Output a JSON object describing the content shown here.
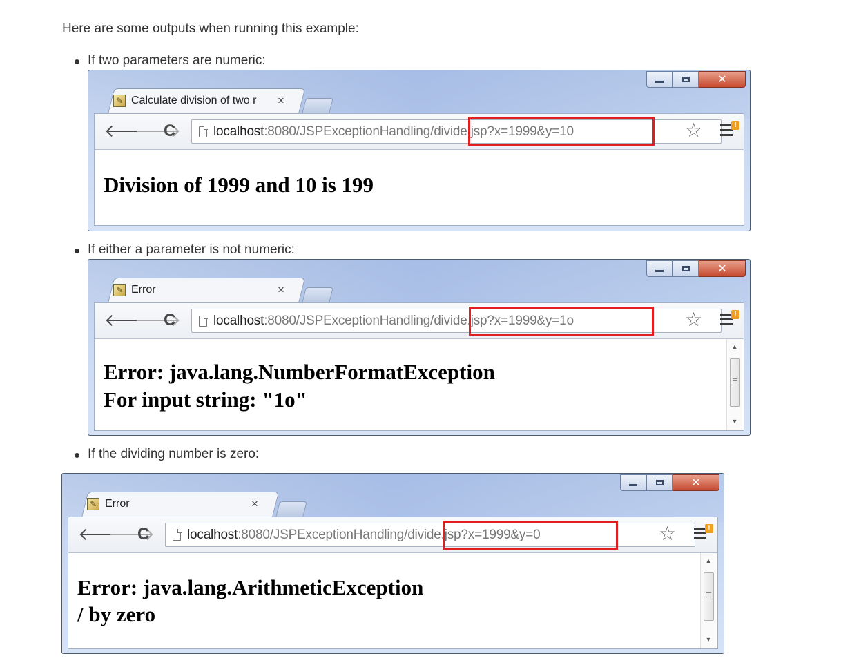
{
  "intro": "Here are some outputs when running this example:",
  "examples": [
    {
      "bullet": "If two parameters are numeric:",
      "tab_title": "Calculate division of two r",
      "url_host": "localhost",
      "url_rest": ":8080/JSPExceptionHandling/divide.jsp?x=1999&y=10",
      "lines": [
        "Division of 1999 and 10 is 199"
      ]
    },
    {
      "bullet": "If either a parameter is not numeric:",
      "tab_title": "Error",
      "url_host": "localhost",
      "url_rest": ":8080/JSPExceptionHandling/divide.jsp?x=1999&y=1o",
      "lines": [
        "Error: java.lang.NumberFormatException",
        "For input string: \"1o\""
      ]
    },
    {
      "bullet": "If the dividing number is zero:",
      "tab_title": "Error",
      "url_host": "localhost",
      "url_rest": ":8080/JSPExceptionHandling/divide.jsp?x=1999&y=0",
      "lines": [
        "Error: java.lang.ArithmeticException",
        "/ by zero"
      ]
    }
  ],
  "icons": {
    "back": "back-arrow-icon",
    "forward": "forward-arrow-icon",
    "reload": "reload-icon",
    "bookmark": "star-icon",
    "menu": "menu-icon"
  },
  "colors": {
    "highlight": "#e02020",
    "close_button": "#c64a30"
  }
}
